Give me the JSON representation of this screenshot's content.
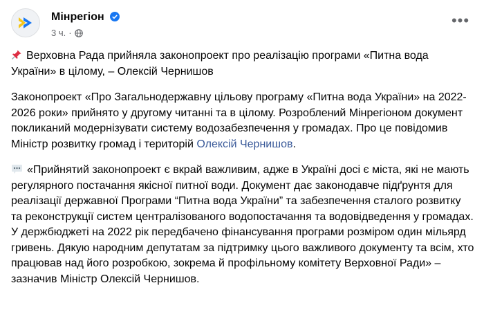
{
  "post": {
    "page_name": "Мінрегіон",
    "time": "3 ч.",
    "dot": "·",
    "more_icon": "ellipsis-icon",
    "colors": {
      "accent_yellow": "#f5c518",
      "accent_blue": "#1877f2",
      "link": "#385898",
      "muted": "#65676b"
    },
    "paragraph1": {
      "emoji": "pushpin-icon",
      "text": "Верховна Рада прийняла законопроект про реалізацію програми «Питна вода України» в цілому, – Олексій Чернишов"
    },
    "paragraph2": {
      "text": "Законопроект «Про Загальнодержавну цільову програму «Питна вода України» на 2022-2026 роки» прийнято у другому читанні та в цілому. Розроблений Мінрегіоном документ покликаний модернізувати систему водозабезпечення у громадах. Про це повідомив Міністр розвитку громад і територій ",
      "link": "Олексій Чернишов",
      "suffix": "."
    },
    "paragraph3": {
      "emoji": "speech-bubble-icon",
      "text": "«Прийнятий законопроект є вкрай важливим, адже в Україні досі є міста, які не мають регулярного постачання якісної питної води. Документ дає законодавче підґрунтя для реалізації державної Програми “Питна вода України” та забезпечення сталого розвитку та реконструкції систем централізованого водопостачання та водовідведення у громадах.  У держбюджеті на 2022 рік передбачено фінансування програми розміром один мільярд гривень. Дякую народним депутатам за підтримку цього важливого документу та всім, хто працював над його розробкою, зокрема й профільному комітету Верховної Ради»  – зазначив Міністр Олексій Чернишов."
    }
  }
}
